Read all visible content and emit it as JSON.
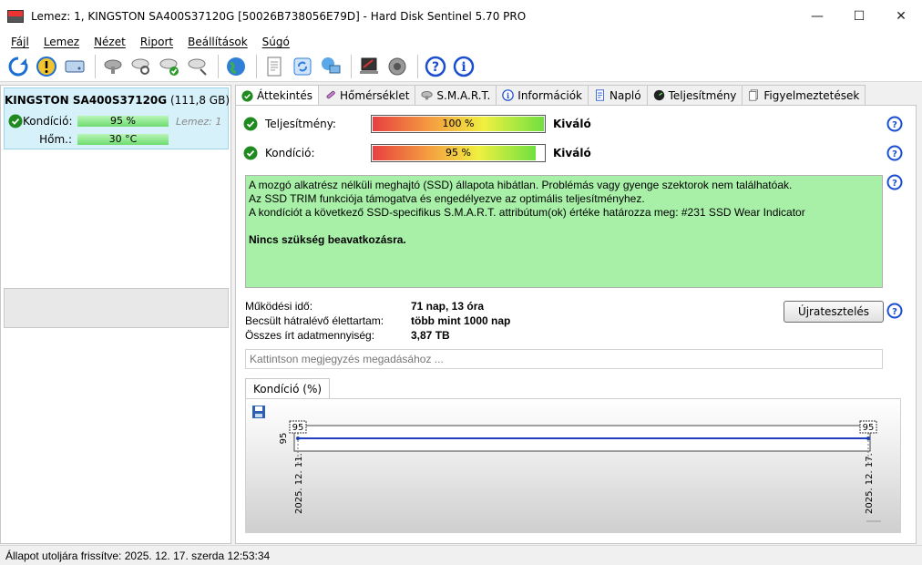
{
  "window": {
    "title": "Lemez: 1, KINGSTON SA400S37120G [50026B738056E79D]  -  Hard Disk Sentinel 5.70 PRO",
    "minimize": "—",
    "maximize": "☐",
    "close": "✕"
  },
  "menu": [
    "Fájl",
    "Lemez",
    "Nézet",
    "Riport",
    "Beállítások",
    "Súgó"
  ],
  "disk_card": {
    "model": "KINGSTON SA400S37120G",
    "size": "(111,8 GB)",
    "health_label": "Kondíció:",
    "health_value": "95 %",
    "health_disk": "Lemez: 1",
    "temp_label": "Hőm.:",
    "temp_value": "30 °C"
  },
  "tabs": [
    {
      "label": "Áttekintés",
      "icon": "check-icon"
    },
    {
      "label": "Hőmérséklet",
      "icon": "thermometer-icon"
    },
    {
      "label": "S.M.A.R.T.",
      "icon": "smart-icon"
    },
    {
      "label": "Információk",
      "icon": "info-icon"
    },
    {
      "label": "Napló",
      "icon": "log-icon"
    },
    {
      "label": "Teljesítmény",
      "icon": "gauge-icon"
    },
    {
      "label": "Figyelmeztetések",
      "icon": "alerts-icon"
    }
  ],
  "overview": {
    "performance_label": "Teljesítmény:",
    "performance_percent": "100 %",
    "performance_level": 1.0,
    "performance_rating": "Kiváló",
    "health_label": "Kondíció:",
    "health_percent": "95 %",
    "health_level": 0.95,
    "health_rating": "Kiváló",
    "description": [
      "A mozgó alkatrész nélküli meghajtó (SSD) állapota hibátlan. Problémás vagy gyenge szektorok nem találhatóak.",
      "Az SSD TRIM funkciója támogatva és engedélyezve az optimális teljesítményhez.",
      "A kondíciót a következő SSD-specifikus S.M.A.R.T. attribútum(ok) értéke határozza meg:  #231 SSD Wear Indicator"
    ],
    "recommendation": "Nincs szükség beavatkozásra.",
    "stats": [
      {
        "label": "Működési idő:",
        "value": "71 nap, 13 óra"
      },
      {
        "label": "Becsült hátralévő élettartam:",
        "value": "több mint 1000 nap"
      },
      {
        "label": "Összes írt adatmennyiség:",
        "value": "3,87 TB"
      }
    ],
    "reset_button": "Újratesztelés",
    "note_placeholder": "Kattintson megjegyzés megadásához ..."
  },
  "chart_tab": "Kondíció  (%)",
  "chart_data": {
    "type": "line",
    "x": [
      "2025. 12. 11.",
      "2025. 12. 17."
    ],
    "series": [
      {
        "values": [
          95,
          95
        ]
      }
    ],
    "ylim": [
      94,
      96
    ],
    "y_tick_label": "95",
    "point_labels": [
      "95",
      "95"
    ],
    "color": "#1f3fbf"
  },
  "status": "Állapot utoljára frissítve: 2025. 12. 17. szerda 12:53:34"
}
